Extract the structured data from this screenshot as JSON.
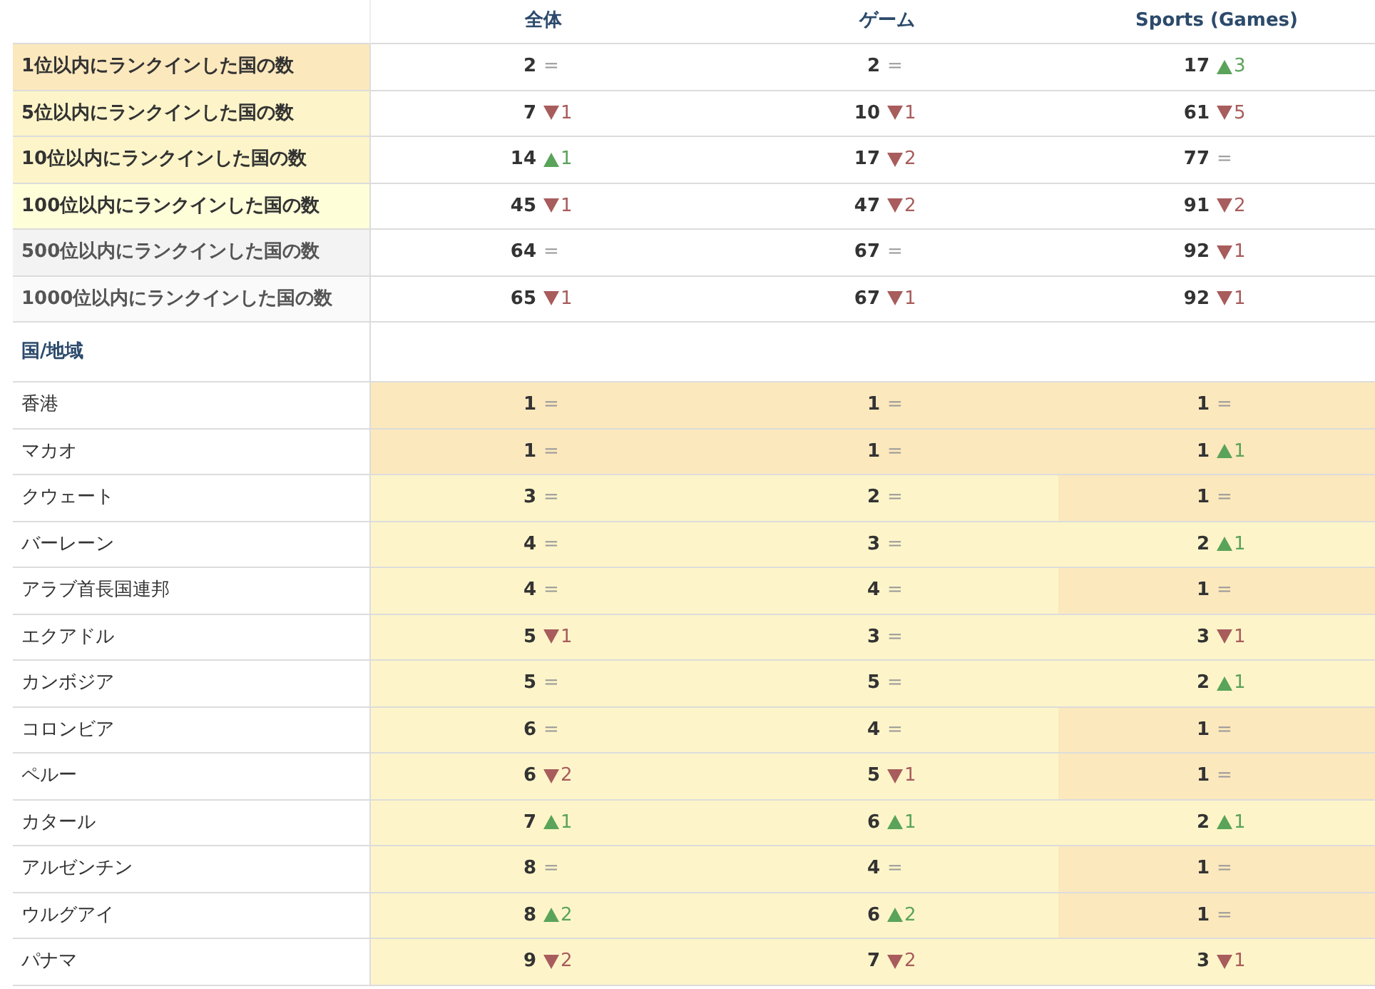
{
  "columns": [
    "全体",
    "ゲーム",
    "Sports (Games)"
  ],
  "summary_rows": [
    {
      "label": "1位以内にランクインした国の数",
      "color": "#fce8bd",
      "muted": false,
      "cells": [
        {
          "value": "2",
          "kind": "same",
          "change": "="
        },
        {
          "value": "2",
          "kind": "same",
          "change": "="
        },
        {
          "value": "17",
          "kind": "up",
          "change": "3"
        }
      ]
    },
    {
      "label": "5位以内にランクインした国の数",
      "color": "#fdf5c9",
      "muted": false,
      "cells": [
        {
          "value": "7",
          "kind": "down",
          "change": "1"
        },
        {
          "value": "10",
          "kind": "down",
          "change": "1"
        },
        {
          "value": "61",
          "kind": "down",
          "change": "5"
        }
      ]
    },
    {
      "label": "10位以内にランクインした国の数",
      "color": "#fdf5c9",
      "muted": false,
      "cells": [
        {
          "value": "14",
          "kind": "up",
          "change": "1"
        },
        {
          "value": "17",
          "kind": "down",
          "change": "2"
        },
        {
          "value": "77",
          "kind": "same",
          "change": "="
        }
      ]
    },
    {
      "label": "100位以内にランクインした国の数",
      "color": "#fefed9",
      "muted": false,
      "cells": [
        {
          "value": "45",
          "kind": "down",
          "change": "1"
        },
        {
          "value": "47",
          "kind": "down",
          "change": "2"
        },
        {
          "value": "91",
          "kind": "down",
          "change": "2"
        }
      ]
    },
    {
      "label": "500位以内にランクインした国の数",
      "color": "#f3f3f3",
      "muted": true,
      "cells": [
        {
          "value": "64",
          "kind": "same",
          "change": "="
        },
        {
          "value": "67",
          "kind": "same",
          "change": "="
        },
        {
          "value": "92",
          "kind": "down",
          "change": "1"
        }
      ]
    },
    {
      "label": "1000位以内にランクインした国の数",
      "color": "#fafafa",
      "muted": true,
      "cells": [
        {
          "value": "65",
          "kind": "down",
          "change": "1"
        },
        {
          "value": "67",
          "kind": "down",
          "change": "1"
        },
        {
          "value": "92",
          "kind": "down",
          "change": "1"
        }
      ]
    }
  ],
  "region_heading": "国/地域",
  "region_rows": [
    {
      "name": "香港",
      "cells": [
        {
          "value": "1",
          "kind": "same",
          "change": "=",
          "color": "#fce8bd"
        },
        {
          "value": "1",
          "kind": "same",
          "change": "=",
          "color": "#fce8bd"
        },
        {
          "value": "1",
          "kind": "same",
          "change": "=",
          "color": "#fce8bd"
        }
      ]
    },
    {
      "name": "マカオ",
      "cells": [
        {
          "value": "1",
          "kind": "same",
          "change": "=",
          "color": "#fce8bd"
        },
        {
          "value": "1",
          "kind": "same",
          "change": "=",
          "color": "#fce8bd"
        },
        {
          "value": "1",
          "kind": "up",
          "change": "1",
          "color": "#fce8bd"
        }
      ]
    },
    {
      "name": "クウェート",
      "cells": [
        {
          "value": "3",
          "kind": "same",
          "change": "=",
          "color": "#fdf5c9"
        },
        {
          "value": "2",
          "kind": "same",
          "change": "=",
          "color": "#fdf5c9"
        },
        {
          "value": "1",
          "kind": "same",
          "change": "=",
          "color": "#fce8bd"
        }
      ]
    },
    {
      "name": "バーレーン",
      "cells": [
        {
          "value": "4",
          "kind": "same",
          "change": "=",
          "color": "#fdf5c9"
        },
        {
          "value": "3",
          "kind": "same",
          "change": "=",
          "color": "#fdf5c9"
        },
        {
          "value": "2",
          "kind": "up",
          "change": "1",
          "color": "#fdf5c9"
        }
      ]
    },
    {
      "name": "アラブ首長国連邦",
      "cells": [
        {
          "value": "4",
          "kind": "same",
          "change": "=",
          "color": "#fdf5c9"
        },
        {
          "value": "4",
          "kind": "same",
          "change": "=",
          "color": "#fdf5c9"
        },
        {
          "value": "1",
          "kind": "same",
          "change": "=",
          "color": "#fce8bd"
        }
      ]
    },
    {
      "name": "エクアドル",
      "cells": [
        {
          "value": "5",
          "kind": "down",
          "change": "1",
          "color": "#fdf5c9"
        },
        {
          "value": "3",
          "kind": "same",
          "change": "=",
          "color": "#fdf5c9"
        },
        {
          "value": "3",
          "kind": "down",
          "change": "1",
          "color": "#fdf5c9"
        }
      ]
    },
    {
      "name": "カンボジア",
      "cells": [
        {
          "value": "5",
          "kind": "same",
          "change": "=",
          "color": "#fdf5c9"
        },
        {
          "value": "5",
          "kind": "same",
          "change": "=",
          "color": "#fdf5c9"
        },
        {
          "value": "2",
          "kind": "up",
          "change": "1",
          "color": "#fdf5c9"
        }
      ]
    },
    {
      "name": "コロンビア",
      "cells": [
        {
          "value": "6",
          "kind": "same",
          "change": "=",
          "color": "#fdf5c9"
        },
        {
          "value": "4",
          "kind": "same",
          "change": "=",
          "color": "#fdf5c9"
        },
        {
          "value": "1",
          "kind": "same",
          "change": "=",
          "color": "#fce8bd"
        }
      ]
    },
    {
      "name": "ペルー",
      "cells": [
        {
          "value": "6",
          "kind": "down",
          "change": "2",
          "color": "#fdf5c9"
        },
        {
          "value": "5",
          "kind": "down",
          "change": "1",
          "color": "#fdf5c9"
        },
        {
          "value": "1",
          "kind": "same",
          "change": "=",
          "color": "#fce8bd"
        }
      ]
    },
    {
      "name": "カタール",
      "cells": [
        {
          "value": "7",
          "kind": "up",
          "change": "1",
          "color": "#fdf5c9"
        },
        {
          "value": "6",
          "kind": "up",
          "change": "1",
          "color": "#fdf5c9"
        },
        {
          "value": "2",
          "kind": "up",
          "change": "1",
          "color": "#fdf5c9"
        }
      ]
    },
    {
      "name": "アルゼンチン",
      "cells": [
        {
          "value": "8",
          "kind": "same",
          "change": "=",
          "color": "#fdf5c9"
        },
        {
          "value": "4",
          "kind": "same",
          "change": "=",
          "color": "#fdf5c9"
        },
        {
          "value": "1",
          "kind": "same",
          "change": "=",
          "color": "#fce8bd"
        }
      ]
    },
    {
      "name": "ウルグアイ",
      "cells": [
        {
          "value": "8",
          "kind": "up",
          "change": "2",
          "color": "#fdf5c9"
        },
        {
          "value": "6",
          "kind": "up",
          "change": "2",
          "color": "#fdf5c9"
        },
        {
          "value": "1",
          "kind": "same",
          "change": "=",
          "color": "#fce8bd"
        }
      ]
    },
    {
      "name": "パナマ",
      "cells": [
        {
          "value": "9",
          "kind": "down",
          "change": "2",
          "color": "#fdf5c9"
        },
        {
          "value": "7",
          "kind": "down",
          "change": "2",
          "color": "#fdf5c9"
        },
        {
          "value": "3",
          "kind": "down",
          "change": "1",
          "color": "#fdf5c9"
        }
      ]
    }
  ]
}
